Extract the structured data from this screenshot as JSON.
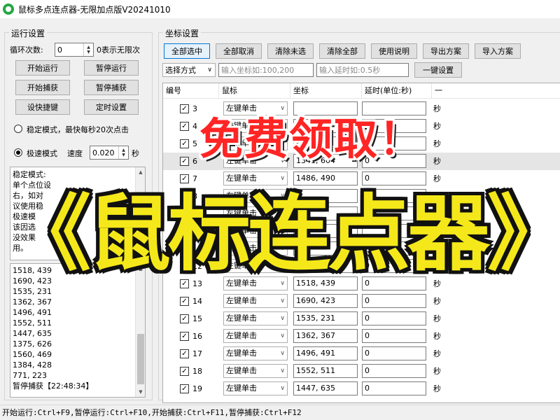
{
  "window": {
    "title": "鼠标多点连点器-无限加点版V20241010"
  },
  "run_settings": {
    "group_title": "运行设置",
    "loop_label": "循环次数:",
    "loop_value": "0",
    "loop_hint": "0表示无限次",
    "btn_start": "开始运行",
    "btn_pause": "暂停运行",
    "btn_start_capture": "开始捕获",
    "btn_pause_capture": "暂停捕获",
    "btn_hotkey": "设快捷键",
    "btn_timer": "定时设置",
    "mode_stable": "稳定模式，最快每秒20次点击",
    "mode_fast": "极速模式",
    "speed_label": "速度",
    "speed_value": "0.020",
    "speed_unit": "秒",
    "notes": [
      "稳定模式:",
      "单个点位设",
      "右，如对",
      "议使用稳",
      "",
      "极速模",
      "该因选",
      "没效果",
      "用。"
    ]
  },
  "log": {
    "lines": [
      "1518, 439",
      "1690, 423",
      "1535, 231",
      "1362, 367",
      "1496, 491",
      "1552, 511",
      "1447, 635",
      "1375, 626",
      "1560, 469",
      "1384, 428",
      "771, 223",
      "暂停捕获【22:48:34】"
    ]
  },
  "coords": {
    "group_title": "坐标设置",
    "buttons": [
      "全部选中",
      "全部取消",
      "清除未选",
      "清除全部",
      "使用说明",
      "导出方案",
      "导入方案"
    ],
    "select_mode": "选择方式",
    "coord_placeholder": "输入坐标如:100,200",
    "delay_placeholder": "输入延时如:0.5秒",
    "btn_apply": "一键设置",
    "headers": [
      "编号",
      "鼠标",
      "坐标",
      "延时(单位:秒)",
      "一"
    ],
    "rows": [
      {
        "num": "3",
        "mouse": "左键单击",
        "coord": "",
        "delay": "",
        "unit": "秒"
      },
      {
        "num": "4",
        "mouse": "左键单击",
        "coord": "",
        "delay": "",
        "unit": "秒"
      },
      {
        "num": "5",
        "mouse": "左键单击",
        "coord": "",
        "delay": "",
        "unit": "秒"
      },
      {
        "num": "6",
        "mouse": "左键单击",
        "coord": "1341, 604",
        "delay": "0",
        "unit": "秒"
      },
      {
        "num": "7",
        "mouse": "左键单击",
        "coord": "1486, 490",
        "delay": "0",
        "unit": "秒"
      },
      {
        "num": "8",
        "mouse": "左键单击",
        "coord": "",
        "delay": "",
        "unit": "秒"
      },
      {
        "num": "9",
        "mouse": "左键单击",
        "coord": "",
        "delay": "",
        "unit": "秒"
      },
      {
        "num": "10",
        "mouse": "左键单击",
        "coord": "",
        "delay": "",
        "unit": "秒"
      },
      {
        "num": "11",
        "mouse": "左键单击",
        "coord": "",
        "delay": "",
        "unit": "秒"
      },
      {
        "num": "12",
        "mouse": "左键单击",
        "coord": "1172, 591",
        "delay": "0",
        "unit": "秒"
      },
      {
        "num": "13",
        "mouse": "左键单击",
        "coord": "1518, 439",
        "delay": "0",
        "unit": "秒"
      },
      {
        "num": "14",
        "mouse": "左键单击",
        "coord": "1690, 423",
        "delay": "0",
        "unit": "秒"
      },
      {
        "num": "15",
        "mouse": "左键单击",
        "coord": "1535, 231",
        "delay": "0",
        "unit": "秒"
      },
      {
        "num": "16",
        "mouse": "左键单击",
        "coord": "1362, 367",
        "delay": "0",
        "unit": "秒"
      },
      {
        "num": "17",
        "mouse": "左键单击",
        "coord": "1496, 491",
        "delay": "0",
        "unit": "秒"
      },
      {
        "num": "18",
        "mouse": "左键单击",
        "coord": "1552, 511",
        "delay": "0",
        "unit": "秒"
      },
      {
        "num": "19",
        "mouse": "左键单击",
        "coord": "1447, 635",
        "delay": "0",
        "unit": "秒"
      }
    ]
  },
  "status_bar": "开始运行:Ctrl+F9,暂停运行:Ctrl+F10,开始捕获:Ctrl+F11,暂停捕获:Ctrl+F12",
  "overlay": {
    "top": "免费领取！",
    "main": "《鼠标连点器》"
  }
}
